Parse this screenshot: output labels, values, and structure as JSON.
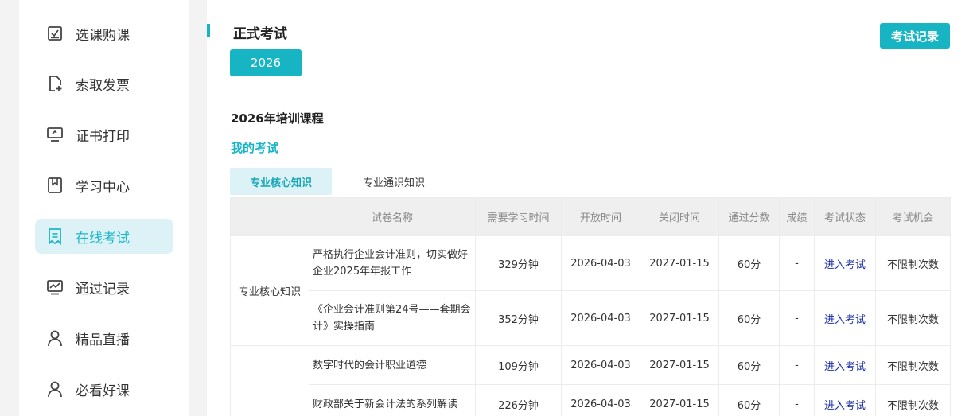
{
  "sidebar": {
    "items": [
      {
        "label": "选课购课",
        "icon": "checkbox-icon",
        "active": false
      },
      {
        "label": "索取发票",
        "icon": "invoice-add-icon",
        "active": false
      },
      {
        "label": "证书打印",
        "icon": "monitor-icon",
        "active": false
      },
      {
        "label": "学习中心",
        "icon": "bookmark-icon",
        "active": false
      },
      {
        "label": "在线考试",
        "icon": "exam-doc-icon",
        "active": true
      },
      {
        "label": "通过记录",
        "icon": "chart-icon",
        "active": false
      },
      {
        "label": "精品直播",
        "icon": "user-icon",
        "active": false
      },
      {
        "label": "必看好课",
        "icon": "user-icon",
        "active": false
      }
    ]
  },
  "main": {
    "title": "正式考试",
    "record_button": "考试记录",
    "year": "2026",
    "section_title": "2026年培训课程",
    "my_exam": "我的考试",
    "tabs": [
      {
        "label": "专业核心知识",
        "active": true
      },
      {
        "label": "专业通识知识",
        "active": false
      }
    ],
    "table": {
      "headers": [
        "试卷名称",
        "需要学习时间",
        "开放时间",
        "关闭时间",
        "通过分数",
        "成绩",
        "考试状态",
        "考试机会"
      ],
      "group_label": "专业核心知识",
      "rows": [
        {
          "name": "严格执行企业会计准则，切实做好企业2025年年报工作",
          "time": "329分钟",
          "open": "2026-04-03",
          "close": "2027-01-15",
          "pass": "60分",
          "score": "-",
          "status": "进入考试",
          "chance": "不限制次数"
        },
        {
          "name": "《企业会计准则第24号——套期会计》实操指南",
          "time": "352分钟",
          "open": "2026-04-03",
          "close": "2027-01-15",
          "pass": "60分",
          "score": "-",
          "status": "进入考试",
          "chance": "不限制次数"
        },
        {
          "name": "数字时代的会计职业道德",
          "time": "109分钟",
          "open": "2026-04-03",
          "close": "2027-01-15",
          "pass": "60分",
          "score": "-",
          "status": "进入考试",
          "chance": "不限制次数"
        },
        {
          "name": "财政部关于新会计法的系列解读",
          "time": "226分钟",
          "open": "2026-04-03",
          "close": "2027-01-15",
          "pass": "60分",
          "score": "-",
          "status": "进入考试",
          "chance": "不限制次数"
        }
      ]
    }
  },
  "colors": {
    "accent": "#17b5c4",
    "active_bg": "#dcf2f6",
    "link": "#1a2ea6"
  }
}
